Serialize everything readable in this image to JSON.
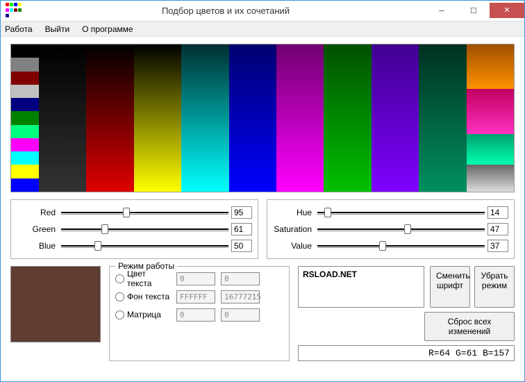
{
  "window": {
    "title": "Подбор цветов и их сочетаний"
  },
  "menu": {
    "work": "Работа",
    "exit": "Выйти",
    "about": "О программе"
  },
  "palette_swatches": [
    "#000000",
    "#808080",
    "#800000",
    "#c0c0c0",
    "#000080",
    "#008000",
    "#00ff7f",
    "#ff00ff",
    "#00ffff",
    "#ffff00",
    "#0000ff"
  ],
  "rgb": {
    "red_label": "Red",
    "red_value": "95",
    "green_label": "Green",
    "green_value": "61",
    "blue_label": "Blue",
    "blue_value": "50"
  },
  "hsv": {
    "hue_label": "Hue",
    "hue_value": "14",
    "sat_label": "Saturation",
    "sat_value": "47",
    "val_label": "Value",
    "val_value": "37"
  },
  "preview_color": "#5f3d32",
  "mode": {
    "legend": "Режим работы",
    "text_color": "Цвет текста",
    "text_hex": "0",
    "text_dec": "0",
    "bg_color": "Фон текста",
    "bg_hex": "FFFFFF",
    "bg_dec": "16777215",
    "matrix": "Матрица",
    "matrix_hex": "0",
    "matrix_dec": "0"
  },
  "sample_text": "RSLOAD.NET",
  "buttons": {
    "change_font": "Сменить шрифт",
    "remove_mode": "Убрать режим",
    "reset_all": "Сброс всех изменений"
  },
  "status": "R=64  G=61  B=157",
  "slider_positions": {
    "red": 37,
    "green": 24,
    "blue": 20,
    "hue": 4,
    "sat": 52,
    "val": 37
  }
}
